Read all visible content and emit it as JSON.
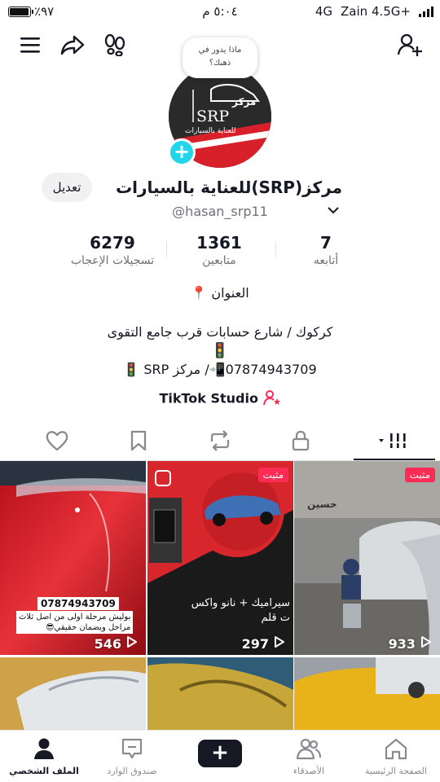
{
  "status_bar": {
    "battery": "٪٩٧",
    "battery_level": 0.97,
    "time": "٥:٠٤ م",
    "network": "4G",
    "carrier": "Zain 4.5G+"
  },
  "profile": {
    "bubble_text_1": "ماذا يدور في",
    "bubble_text_2": "ذهنك؟",
    "logo_title": "مركز",
    "logo_brand": "SRP",
    "logo_sub": "للعناية بالسيارات",
    "display_name": "مركز(SRP)للعناية بالسيارات",
    "username": "@hasan_srp11",
    "edit_label": "تعديل"
  },
  "stats": [
    {
      "value": "7",
      "label": "أتابعه"
    },
    {
      "value": "1361",
      "label": "متابعين"
    },
    {
      "value": "6279",
      "label": "تسجيلات الإعجاب"
    }
  ],
  "bio": {
    "line1": "العنوان",
    "line2": "كركوك / شارع حسابات قرب جامع التقوى",
    "line3": "07874943709📲/ مركز SRP 🚦",
    "studio": "TikTok Studio"
  },
  "grid": {
    "items": [
      {
        "views": "546",
        "phone": "07874943709",
        "caption1": "بوليش مرحلة اولى من اصل ثلاث",
        "caption2": "مراحل ويضمان حقيقي😎"
      },
      {
        "views": "297",
        "pinned": "مثبت",
        "caption1": "سيراميك + نانو واكس",
        "caption2": "ت قلم"
      },
      {
        "views": "933",
        "pinned": "مثبت",
        "wall": "حسين"
      }
    ]
  },
  "bottom_nav": [
    {
      "label": "الصفحة الرئيسية"
    },
    {
      "label": "الأصدقاء"
    },
    {
      "label": "صندوق الوارد"
    },
    {
      "label": "الملف الشخصي"
    }
  ],
  "colors": {
    "accent": "#fe2c55",
    "cyan": "#25f4ee",
    "badge": "#20d5ec"
  }
}
